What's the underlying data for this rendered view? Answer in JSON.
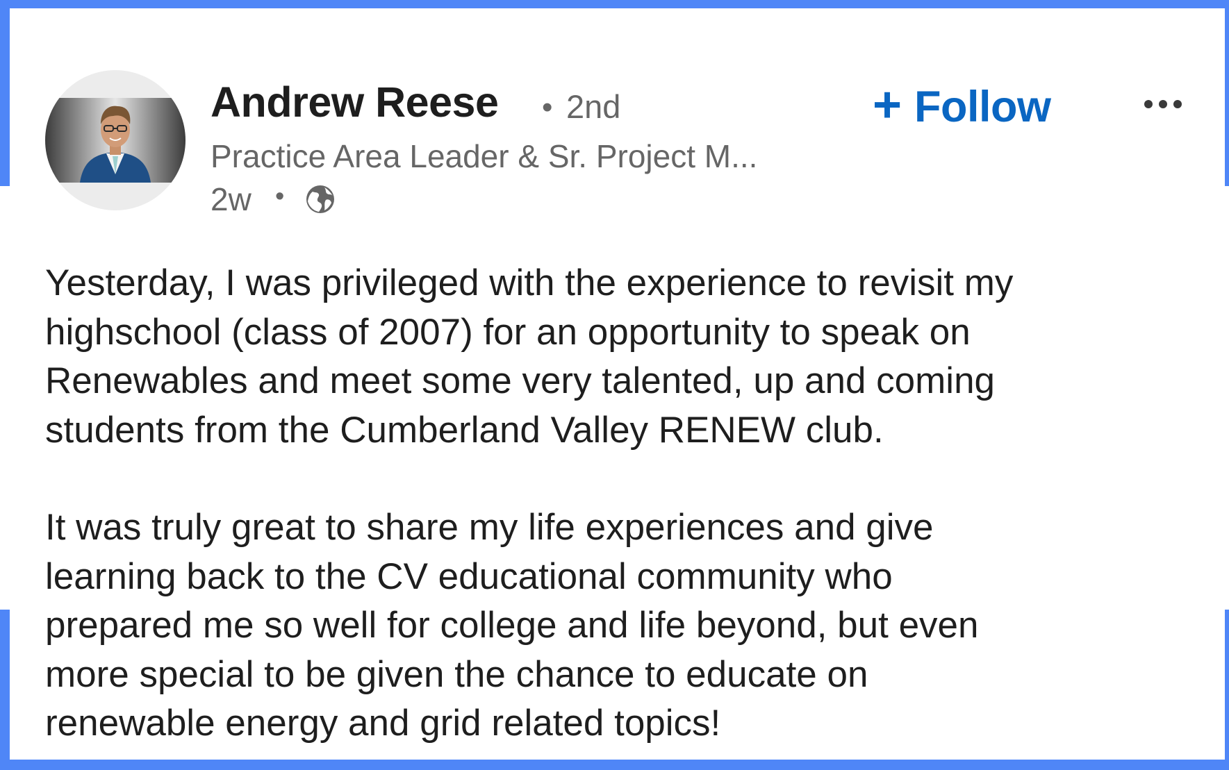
{
  "post": {
    "author": {
      "name": "Andrew Reese",
      "degree_separator": "•",
      "degree": "2nd",
      "headline": "Practice Area Leader & Sr. Project M...",
      "timestamp": "2w",
      "timestamp_separator": "•",
      "visibility_icon": "globe-icon",
      "avatar_icon": "profile-photo"
    },
    "follow": {
      "icon": "plus-icon",
      "plus_glyph": "+",
      "label": "Follow"
    },
    "more_icon": "more-options-icon",
    "body": {
      "paragraph_1": "Yesterday, I was privileged with the experience to revisit my\nhighschool (class of 2007) for an opportunity to speak on\nRenewables and meet some very talented, up and coming\nstudents from the Cumberland Valley RENEW club.",
      "paragraph_2": "It was truly great to share my life experiences and give\nlearning back to the CV educational community who\nprepared me so well for college and life beyond, but even\nmore special to be given the chance to educate on\nrenewable energy and grid related topics!"
    }
  },
  "colors": {
    "frame": "#4f86f7",
    "accent": "#0a66c2",
    "text_primary": "#1e1e1e",
    "text_secondary": "#666666"
  }
}
